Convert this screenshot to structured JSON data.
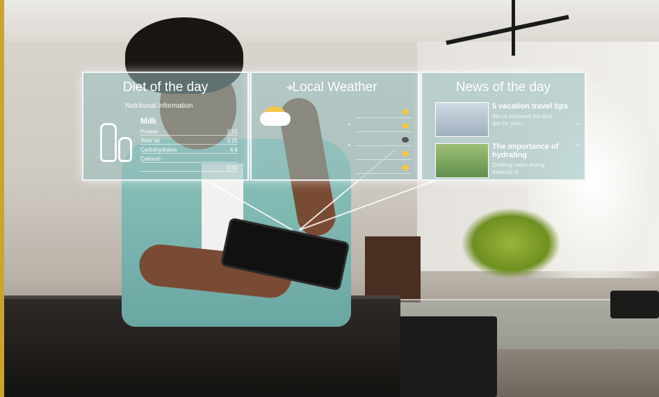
{
  "panels": {
    "diet": {
      "title": "Diet of the day",
      "subtitle": "Nutritional information",
      "item": "Milk",
      "rows": [
        {
          "label": "Protein",
          "value": "3.15"
        },
        {
          "label": "Total fat",
          "value": "3.25"
        },
        {
          "label": "Carbohydrates",
          "value": "4.8"
        },
        {
          "label": "Calcium",
          "value": ""
        },
        {
          "label": "",
          "value": "0.01"
        }
      ]
    },
    "weather": {
      "title": "Local Weather"
    },
    "news": {
      "title": "News of the day",
      "articles": [
        {
          "headline": "5 vacation travel tips",
          "snippet": "We've prepared the best tips for your..."
        },
        {
          "headline": "The importance of hydrating",
          "snippet": "Drinking water during exercise is..."
        }
      ]
    }
  },
  "icons": [
    "location-pin-icon",
    "partly-sunny-icon",
    "milk-bottle-icon",
    "chevron-icon"
  ],
  "colors": {
    "panel": "#96bebe",
    "accent": "#c9a23a"
  }
}
